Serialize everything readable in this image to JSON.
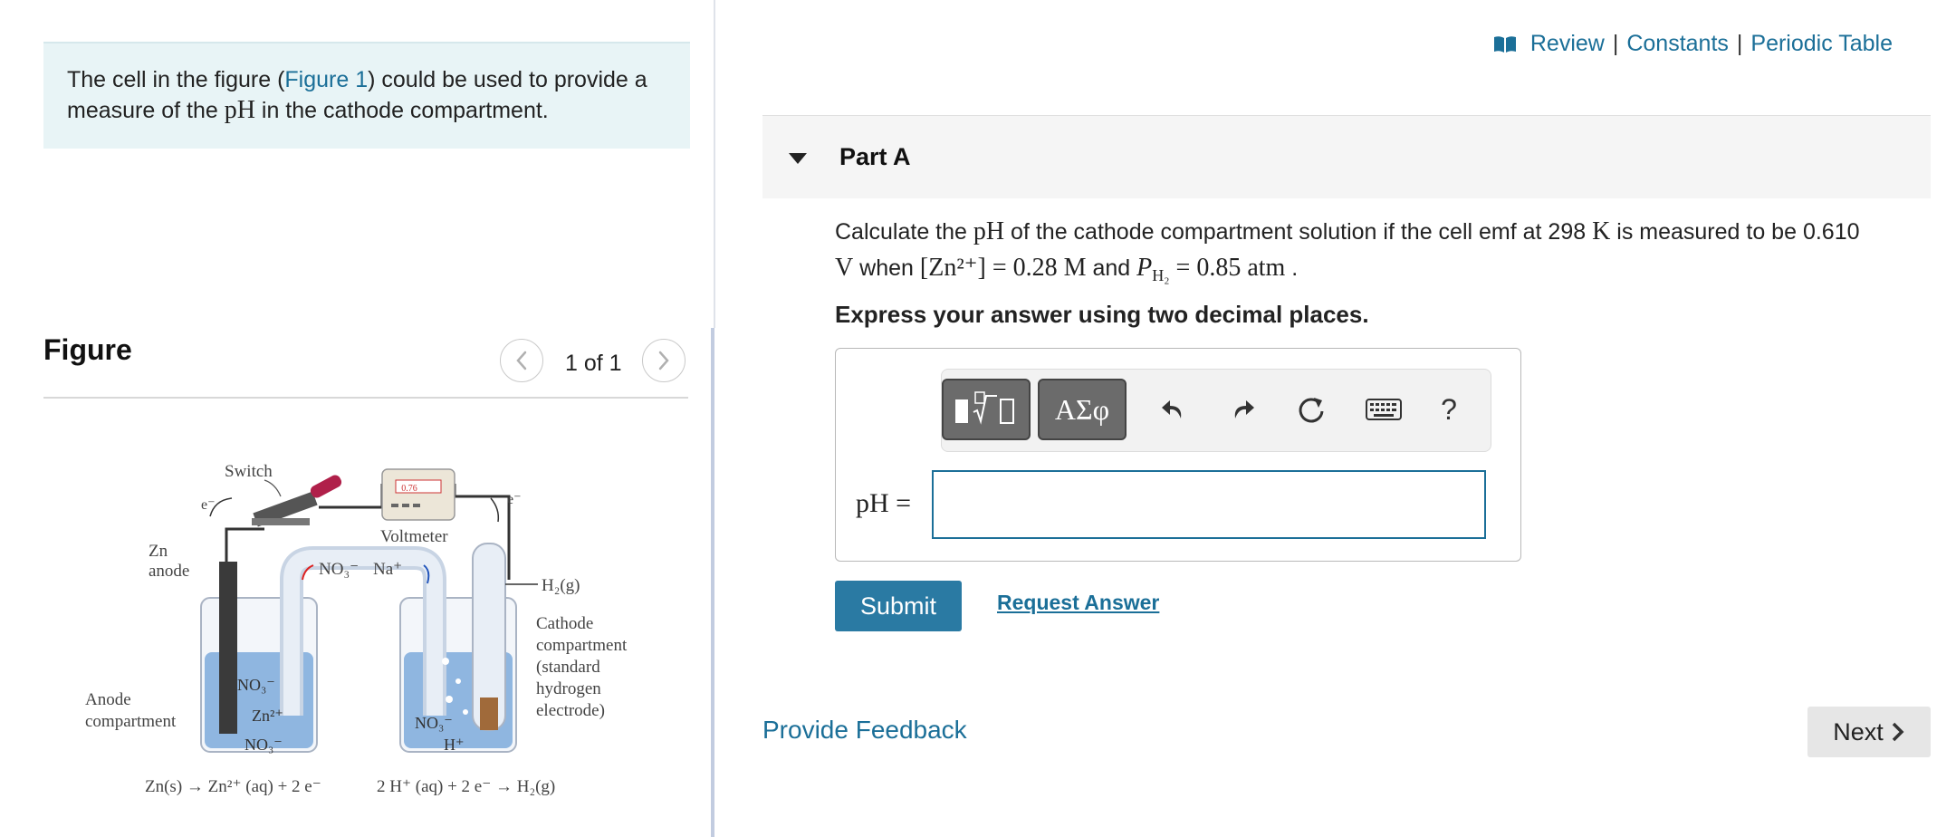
{
  "intro": {
    "text_before": "The cell in the figure (",
    "figure_link": "Figure 1",
    "text_after": ") could be used to provide a measure of the ",
    "ph": "pH",
    "text_end": " in the cathode compartment."
  },
  "figure": {
    "title": "Figure",
    "counter": "1 of 1",
    "labels": {
      "switch": "Switch",
      "e_left": "e⁻",
      "e_right": "e⁻",
      "voltmeter": "Voltmeter",
      "display": "0.76",
      "zn": "Zn",
      "anode": "anode",
      "no3_bridge": "NO₃⁻",
      "na": "Na⁺",
      "h2g": "H₂(g)",
      "cathode1": "Cathode",
      "cathode2": "compartment",
      "cathode3": "(standard",
      "cathode4": "hydrogen",
      "cathode5": "electrode)",
      "anode_comp1": "Anode",
      "anode_comp2": "compartment",
      "no3_a1": "NO₃⁻",
      "zn2": "Zn²⁺",
      "no3_a2": "NO₃⁻",
      "no3_c": "NO₃⁻",
      "h_plus": "H⁺",
      "eq_left": "Zn(s) → Zn²⁺ (aq) + 2 e⁻",
      "eq_right": "2 H⁺ (aq) + 2 e⁻ → H₂(g)"
    }
  },
  "resources": {
    "review": "Review",
    "constants": "Constants",
    "periodic_table": "Periodic Table",
    "separator": "|"
  },
  "part": {
    "title": "Part A"
  },
  "question": {
    "t1": "Calculate the ",
    "ph": "pH",
    "t2": " of the cathode compartment solution if the cell emf at 298 ",
    "k": "K",
    "t3": " is measured to be 0.610 ",
    "v": "V",
    "t4": " when ",
    "zn_expr": "[Zn²⁺] = 0.28 M",
    "t5": " and ",
    "p_expr": "P",
    "p_sub": "H₂",
    "p_val": " = 0.85 atm",
    "t6": " ."
  },
  "instruction": "Express your answer using two decimal places.",
  "answer": {
    "label": "pH =",
    "value": "",
    "toolbar_greek": "ΑΣφ",
    "help": "?"
  },
  "buttons": {
    "submit": "Submit",
    "request_answer": "Request Answer",
    "next": "Next"
  },
  "feedback": "Provide Feedback",
  "colors": {
    "link": "#1b6f98",
    "submit_bg": "#2a7aa3",
    "intro_bg": "#e8f4f6"
  }
}
